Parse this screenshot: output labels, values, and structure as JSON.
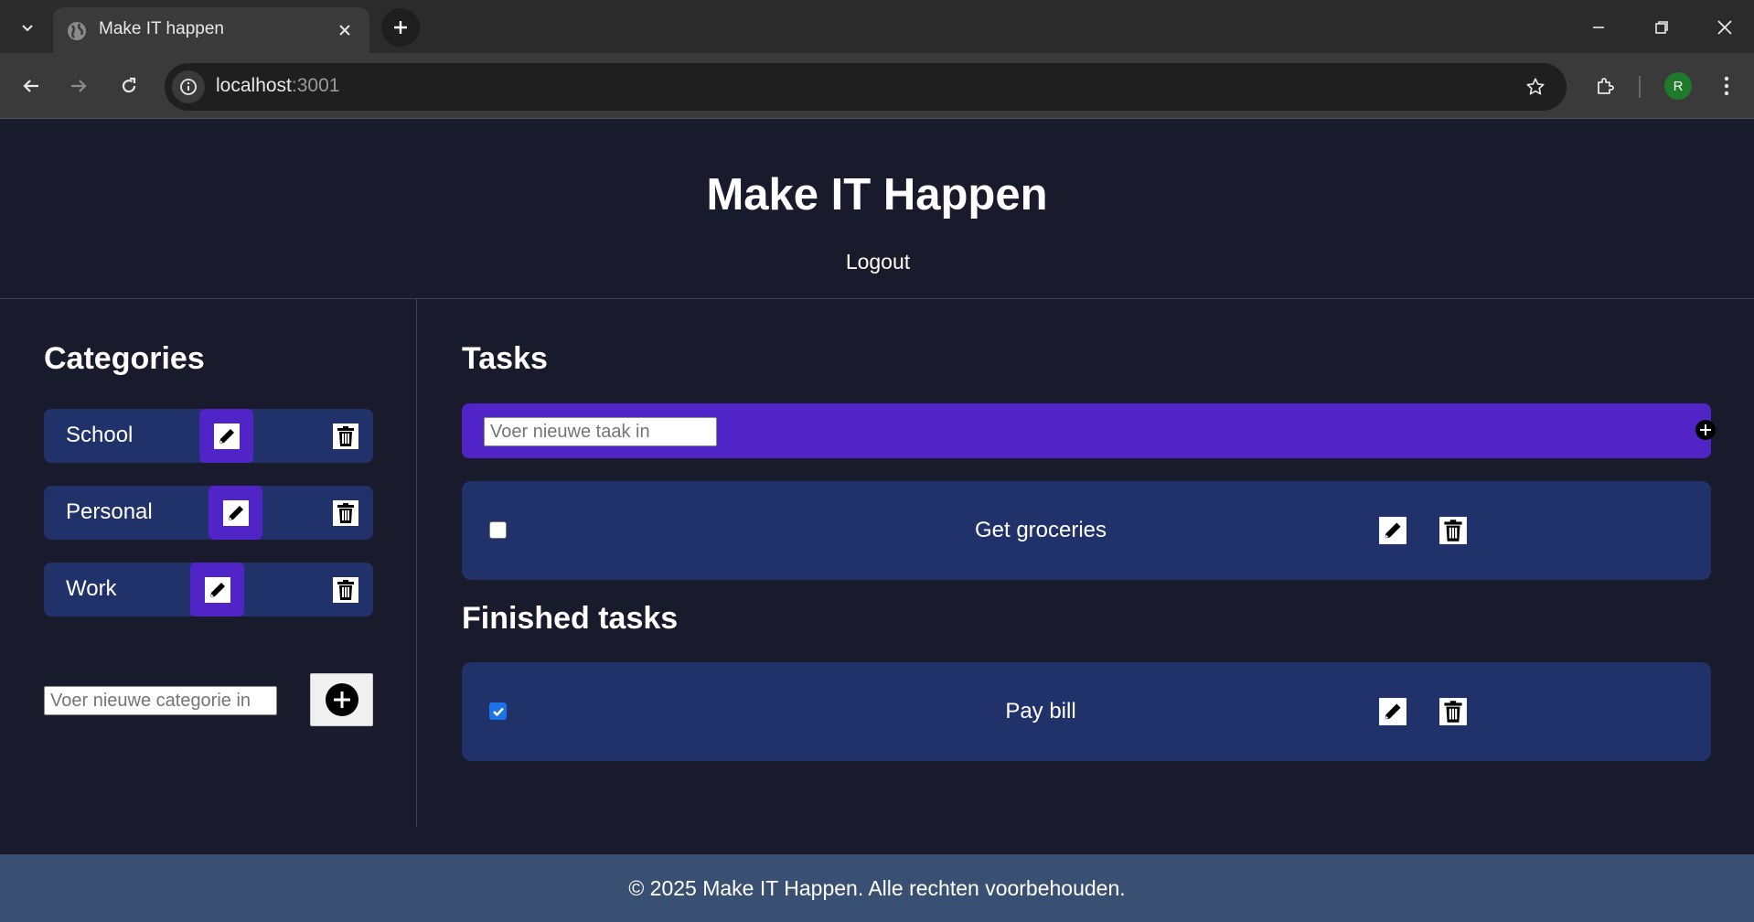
{
  "browser": {
    "tab_title": "Make IT happen",
    "url_host": "localhost",
    "url_port": ":3001",
    "profile_initial": "R"
  },
  "app": {
    "title": "Make IT Happen",
    "logout_label": "Logout"
  },
  "sidebar": {
    "title": "Categories",
    "categories": [
      {
        "label": "School"
      },
      {
        "label": "Personal"
      },
      {
        "label": "Work"
      }
    ],
    "new_category_placeholder": "Voer nieuwe categorie in"
  },
  "tasks": {
    "title": "Tasks",
    "new_task_placeholder": "Voer nieuwe taak in",
    "open": [
      {
        "label": "Get groceries",
        "checked": false
      }
    ],
    "finished_title": "Finished tasks",
    "finished": [
      {
        "label": "Pay bill",
        "checked": true
      }
    ]
  },
  "footer": {
    "text": "© 2025 Make IT Happen. Alle rechten voorbehouden."
  },
  "colors": {
    "page_bg": "#191b2c",
    "card_bg": "#213169",
    "accent": "#5024c6",
    "footer_bg": "#3a5073"
  }
}
